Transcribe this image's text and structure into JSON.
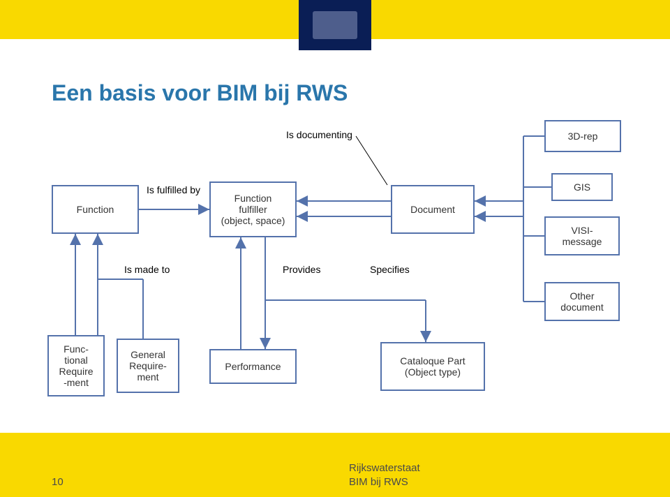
{
  "header": {
    "title": "Een basis voor BIM bij RWS"
  },
  "footer": {
    "page": "10",
    "org": "Rijkswaterstaat",
    "subtitle": "BIM bij RWS"
  },
  "nodes": {
    "function": "Function",
    "fulfiller_l1": "Function",
    "fulfiller_l2": "fulfiller",
    "fulfiller_l3": "(object, space)",
    "document": "Document",
    "rep3d": "3D-rep",
    "gis": "GIS",
    "visi_l1": "VISI-",
    "visi_l2": "message",
    "other_l1": "Other",
    "other_l2": "document",
    "func_req_l1": "Func-",
    "func_req_l2": "tional",
    "func_req_l3": "Require",
    "func_req_l4": "-ment",
    "gen_req_l1": "General",
    "gen_req_l2": "Require-",
    "gen_req_l3": "ment",
    "performance": "Performance",
    "catpart_l1": "Cataloque Part",
    "catpart_l2": "(Object type)"
  },
  "edges": {
    "is_documenting": "Is documenting",
    "is_fulfilled_by": "Is fulfilled by",
    "is_made_to": "Is made to",
    "provides": "Provides",
    "specifies": "Specifies"
  }
}
